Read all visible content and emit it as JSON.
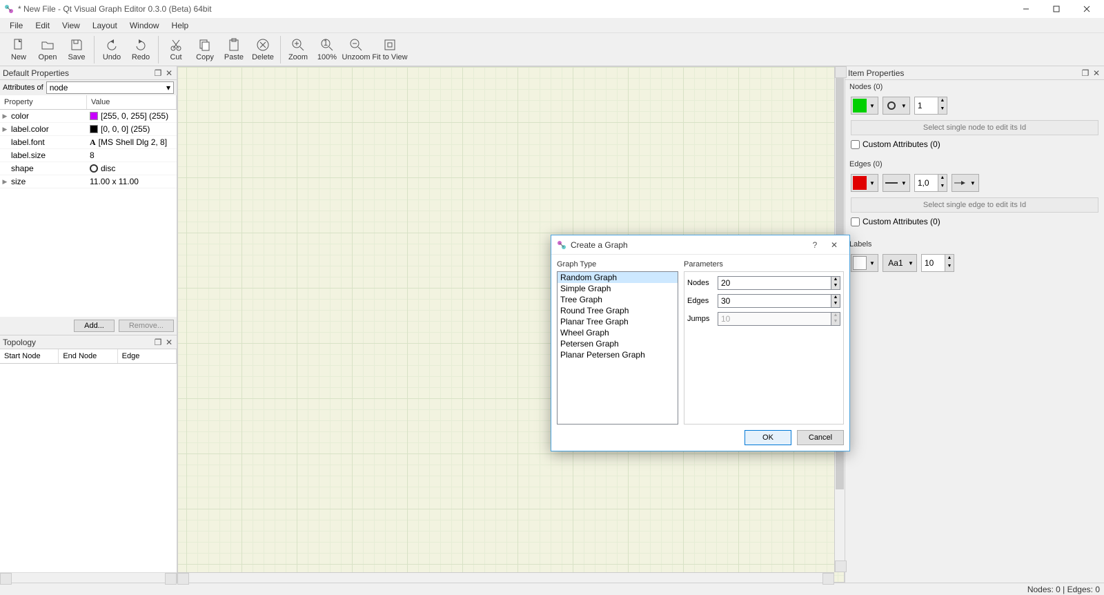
{
  "window": {
    "title": "* New File - Qt Visual Graph Editor 0.3.0 (Beta) 64bit"
  },
  "menus": [
    "File",
    "Edit",
    "View",
    "Layout",
    "Window",
    "Help"
  ],
  "toolbar": {
    "new": "New",
    "open": "Open",
    "save": "Save",
    "undo": "Undo",
    "redo": "Redo",
    "cut": "Cut",
    "copy": "Copy",
    "paste": "Paste",
    "delete": "Delete",
    "zoom": "Zoom",
    "hundred": "100%",
    "unzoom": "Unzoom",
    "fit": "Fit to View"
  },
  "leftPanel": {
    "defaultProps": {
      "title": "Default Properties",
      "attrLabel": "Attributes of",
      "attrValue": "node",
      "headers": {
        "prop": "Property",
        "val": "Value"
      },
      "rows": {
        "color": {
          "name": "color",
          "value": "[255, 0, 255] (255)",
          "swatch": "#c800ff"
        },
        "labelColor": {
          "name": "label.color",
          "value": "[0, 0, 0] (255)",
          "swatch": "#000000"
        },
        "labelFont": {
          "name": "label.font",
          "value": "[MS Shell Dlg 2, 8]",
          "glyph": "A"
        },
        "labelSize": {
          "name": "label.size",
          "value": "8"
        },
        "shape": {
          "name": "shape",
          "value": "disc"
        },
        "size": {
          "name": "size",
          "value": "11.00 x 11.00"
        }
      },
      "addBtn": "Add...",
      "removeBtn": "Remove..."
    },
    "topology": {
      "title": "Topology",
      "headers": {
        "start": "Start Node",
        "end": "End Node",
        "edge": "Edge"
      }
    }
  },
  "rightPanel": {
    "title": "Item Properties",
    "nodes": {
      "title": "Nodes (0)",
      "fillColor": "#00d000",
      "sizeValue": "1",
      "hint": "Select single node to edit its Id",
      "customAttrs": "Custom Attributes (0)"
    },
    "edges": {
      "title": "Edges (0)",
      "color": "#e00000",
      "weightValue": "1,0",
      "hint": "Select single edge to edit its Id",
      "customAttrs": "Custom Attributes (0)"
    },
    "labels": {
      "title": "Labels",
      "fontSample": "Aa1",
      "sizeValue": "10"
    }
  },
  "dialog": {
    "title": "Create a Graph",
    "graphTypeLabel": "Graph Type",
    "paramsLabel": "Parameters",
    "types": [
      "Random Graph",
      "Simple Graph",
      "Tree Graph",
      "Round Tree Graph",
      "Planar Tree Graph",
      "Wheel Graph",
      "Petersen Graph",
      "Planar Petersen Graph"
    ],
    "selectedIndex": 0,
    "params": {
      "nodes": {
        "label": "Nodes",
        "value": "20"
      },
      "edges": {
        "label": "Edges",
        "value": "30"
      },
      "jumps": {
        "label": "Jumps",
        "value": "10"
      }
    },
    "ok": "OK",
    "cancel": "Cancel"
  },
  "status": {
    "text": "Nodes: 0 | Edges: 0"
  }
}
